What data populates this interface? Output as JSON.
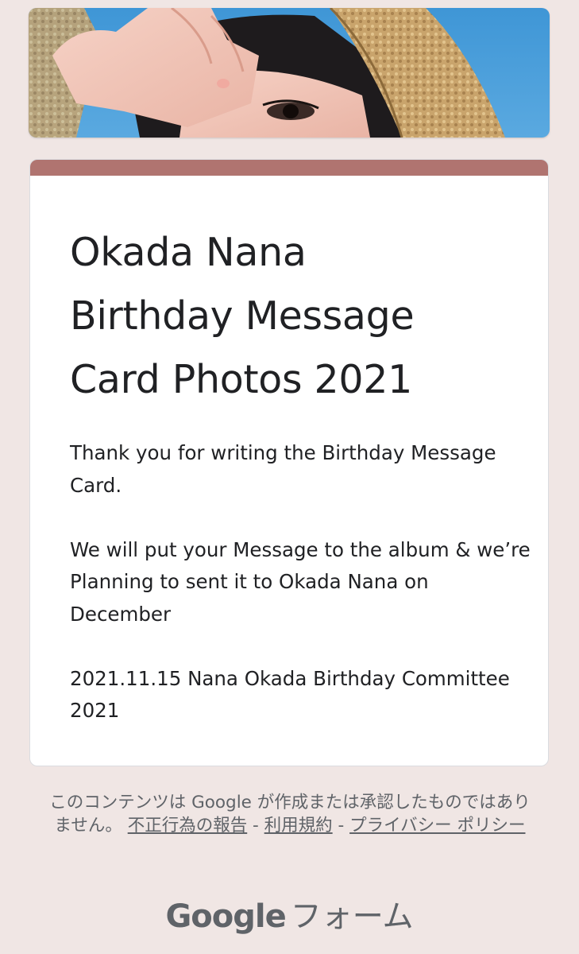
{
  "banner": {
    "alt": "header image"
  },
  "form": {
    "title_lines": [
      "Okada Nana",
      "Birthday Message",
      "Card Photos 2021"
    ],
    "description": [
      "Thank you for writing the Birthday Message Card.",
      "We will put your Message to the album & we’re Planning to sent it to Okada Nana on December",
      "2021.11.15 Nana Okada Birthday Committee 2021"
    ],
    "accent_color": "#b07470"
  },
  "footer": {
    "disclaimer": "このコンテンツは Google が作成または承認したものではありません。",
    "report_link": "不正行為の報告",
    "sep1": " - ",
    "terms_link": "利用規約",
    "sep2": " - ",
    "privacy_link": "プライバシー ポリシー"
  },
  "brand": {
    "google": "Google",
    "forms": "フォーム"
  }
}
